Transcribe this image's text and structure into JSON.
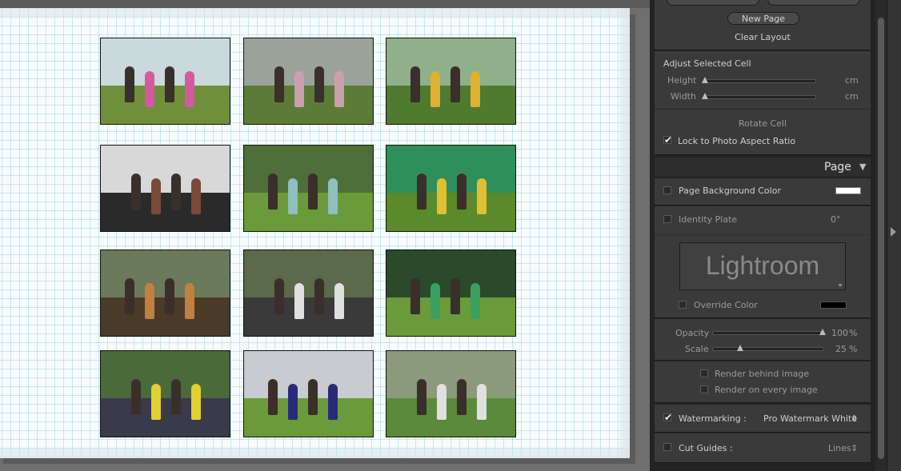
{
  "cell_panel": {
    "new_page_label": "New Page",
    "clear_layout_label": "Clear Layout",
    "adjust_title": "Adjust Selected Cell",
    "height_label": "Height",
    "height_unit": "cm",
    "width_label": "Width",
    "width_unit": "cm",
    "rotate_cell_label": "Rotate Cell",
    "lock_aspect_label": "Lock to Photo Aspect Ratio",
    "lock_aspect_checked": true
  },
  "page_panel": {
    "title": "Page",
    "collapse_glyph": "▼",
    "bg_color_label": "Page Background Color",
    "bg_color_checked": false,
    "bg_color_value": "#ffffff",
    "identity_plate_label": "Identity Plate",
    "identity_plate_checked": false,
    "identity_plate_angle": "0°",
    "identity_plate_text": "Lightroom",
    "override_color_label": "Override Color",
    "override_color_checked": false,
    "override_color_value": "#000000",
    "opacity_label": "Opacity",
    "opacity_value": "100",
    "opacity_unit": "%",
    "opacity_fraction": 1.0,
    "scale_label": "Scale",
    "scale_value": "25",
    "scale_unit": "%",
    "scale_fraction": 0.25,
    "render_behind_label": "Render behind image",
    "render_behind_checked": false,
    "render_every_label": "Render on every image",
    "render_every_checked": false,
    "watermarking_label": "Watermarking :",
    "watermarking_checked": true,
    "watermark_value": "Pro Watermark White",
    "watermark_arrows": "⇕",
    "cut_guides_label": "Cut Guides :",
    "cut_guides_checked": false,
    "cut_guides_value": "Lines",
    "cut_guides_arrows": "⇕"
  },
  "colors": {
    "panel_bg": "#3a3a3a",
    "panel_text": "#cfcfcf",
    "page_bg": "#f7fbfc",
    "grid_line": "#8ccddc"
  },
  "icons": {
    "check": "✔",
    "collapse_right": "right-triangle-icon"
  },
  "photos": [
    {
      "desc": "vineyard-group-photo",
      "sky": "#c9d9dc",
      "ground": "#6f8f3a",
      "accent": "#d45aa0"
    },
    {
      "desc": "wine-barrels-flower-wall",
      "sky": "#9aa39a",
      "ground": "#5c7a38",
      "accent": "#caa0b0"
    },
    {
      "desc": "flower-arch-garden",
      "sky": "#8fb08a",
      "ground": "#4f7a2f",
      "accent": "#e0b030"
    },
    {
      "desc": "women-at-bar",
      "sky": "#d8d8d8",
      "ground": "#2a2a2a",
      "accent": "#7a4a3a"
    },
    {
      "desc": "toast-letters-sign",
      "sky": "#4f6f3a",
      "ground": "#6a9a3a",
      "accent": "#8fbfc0"
    },
    {
      "desc": "green-tent-stall",
      "sky": "#2f8f5a",
      "ground": "#5a8a2a",
      "accent": "#e0c030"
    },
    {
      "desc": "wine-tasting-table",
      "sky": "#6a7a5a",
      "ground": "#4a3a2a",
      "accent": "#c08040"
    },
    {
      "desc": "food-stall-bar",
      "sky": "#5a6a4a",
      "ground": "#3a3a3a",
      "accent": "#e0e0e0"
    },
    {
      "desc": "tommys-banner-lawn",
      "sky": "#2a4a2a",
      "ground": "#6a9a3a",
      "accent": "#3aa060"
    },
    {
      "desc": "umbrella-crowd",
      "sky": "#4a6a3a",
      "ground": "#3a3a4a",
      "accent": "#e0d030"
    },
    {
      "desc": "helicopter-field",
      "sky": "#c8ccd0",
      "ground": "#6a9a3a",
      "accent": "#2a2a7a"
    },
    {
      "desc": "caravan-food-truck",
      "sky": "#8a9a7a",
      "ground": "#5a8a3a",
      "accent": "#e0e0e0"
    }
  ]
}
